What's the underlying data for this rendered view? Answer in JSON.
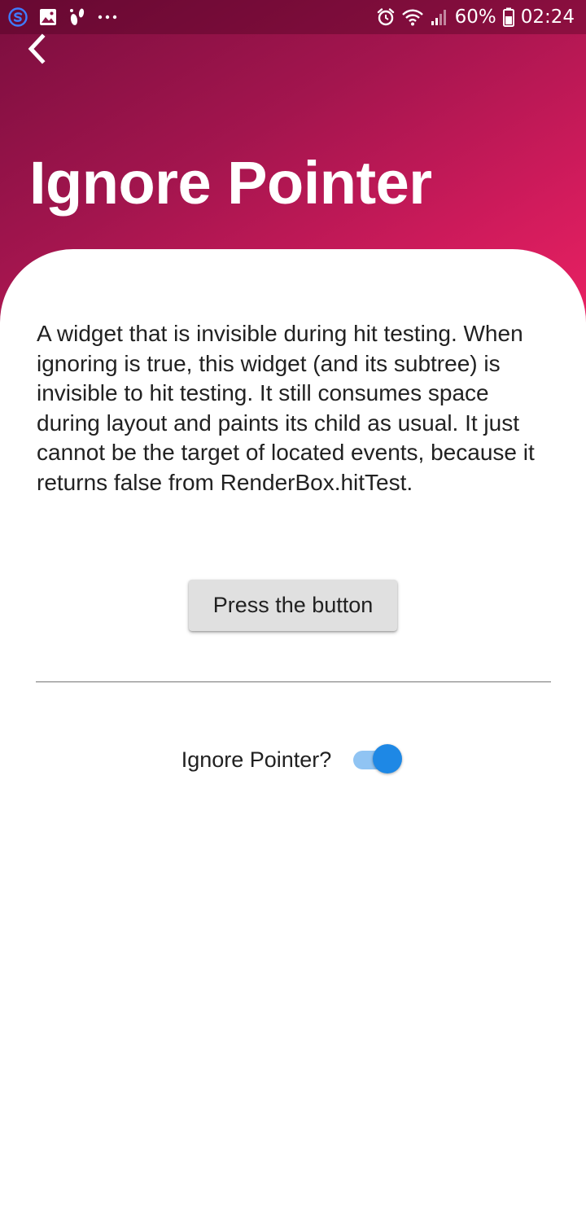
{
  "status_bar": {
    "battery_percent": "60%",
    "time": "02:24",
    "left_icons": [
      "s-app-icon",
      "gallery-icon",
      "usb-debug-icon",
      "more-dots-icon"
    ],
    "right_icons": [
      "alarm-icon",
      "wifi-icon",
      "signal-icon",
      "battery-icon"
    ]
  },
  "header": {
    "back_icon": "chevron-left-icon",
    "title": "Ignore Pointer",
    "gradient_colors": [
      "#7a0e3e",
      "#a3154e",
      "#d11b5c",
      "#ed2263"
    ]
  },
  "content": {
    "description": "A widget that is invisible during hit testing. When ignoring is true, this widget (and its subtree) is invisible to hit testing. It still consumes space during layout and paints its child as usual. It just cannot be the target of located events, because it returns false from RenderBox.hitTest.",
    "button_label": "Press the button",
    "toggle_label": "Ignore Pointer?",
    "toggle_on": true,
    "toggle_color": "#1e88e5"
  }
}
